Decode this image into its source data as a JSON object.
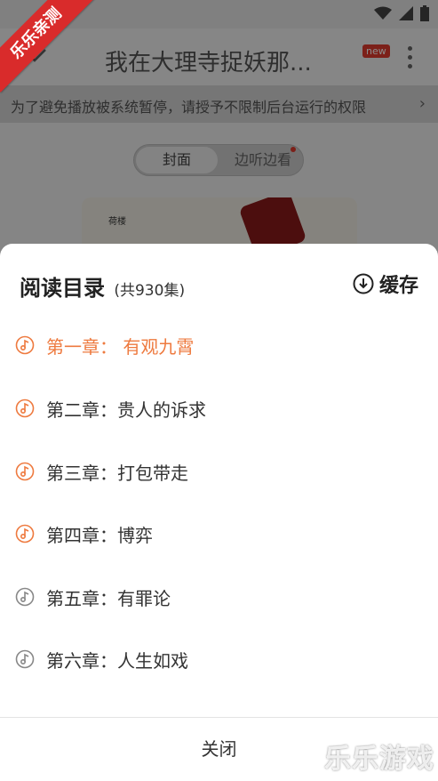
{
  "background": {
    "book_title": "我在大理寺捉妖那...",
    "new_badge": "new",
    "notice_text": "为了避免播放被系统暂停，请授予不限制后台运行的权限",
    "toggle": [
      "封面",
      "边听边看"
    ],
    "cover_side_text": "荷楼"
  },
  "ribbon": {
    "label": "乐乐亲测"
  },
  "sheet": {
    "title": "阅读目录",
    "count": "(共930集)",
    "cache_label": "缓存",
    "chapters": [
      {
        "label": "第一章： 有观九霄",
        "active": true
      },
      {
        "label": "第二章：贵人的诉求",
        "active": false
      },
      {
        "label": "第三章：打包带走",
        "active": false
      },
      {
        "label": "第四章：博弈",
        "active": false
      },
      {
        "label": "第五章：有罪论",
        "active": false
      },
      {
        "label": "第六章：人生如戏",
        "active": false
      }
    ],
    "close_label": "关闭"
  },
  "watermark": {
    "text": "乐乐游戏",
    "url": "www.6ll.com"
  },
  "colors": {
    "accent": "#ee7a3f",
    "badge": "#e23b2e",
    "ribbon": "#d92b2b"
  }
}
